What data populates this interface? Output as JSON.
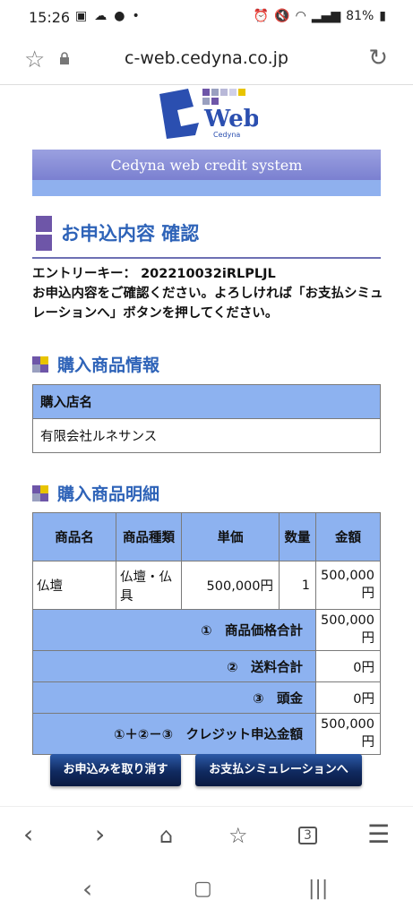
{
  "status_bar": {
    "time": "15:26",
    "battery": "81%"
  },
  "browser": {
    "url": "c-web.cedyna.co.jp"
  },
  "logo": {
    "text": "Web",
    "subtext": "Cedyna"
  },
  "banner": {
    "text": "Cedyna web credit system"
  },
  "page_title": "お申込内容 確認",
  "entry": {
    "key_label": "エントリーキー：",
    "key_value": "202210032iRLPLJL",
    "instructions": "お申込内容をご確認ください。よろしければ「お支払シミュレーションへ」ボタンを押してください。"
  },
  "shop_section": {
    "heading": "購入商品情報",
    "header": "購入店名",
    "value": "有限会社ルネサンス"
  },
  "items_section": {
    "heading": "購入商品明細",
    "columns": [
      "商品名",
      "商品種類",
      "単価",
      "数量",
      "金額"
    ],
    "row": {
      "name": "仏壇",
      "type": "仏壇・仏具",
      "unit_price": "500,000円",
      "qty": "1",
      "amount": "500,000円"
    },
    "summary": [
      {
        "label": "①　商品価格合計",
        "value": "500,000円"
      },
      {
        "label": "②　送料合計",
        "value": "0円"
      },
      {
        "label": "③　頭金",
        "value": "0円"
      },
      {
        "label": "①＋②－③　クレジット申込金額",
        "value": "500,000円"
      }
    ]
  },
  "buttons": {
    "cancel": "お申込みを取り消す",
    "simulate": "お支払シミュレーションへ"
  },
  "tab_count": "3",
  "colors": {
    "accent": "#2e63b8",
    "table_header": "#8db2f0",
    "button": "#102a60"
  }
}
